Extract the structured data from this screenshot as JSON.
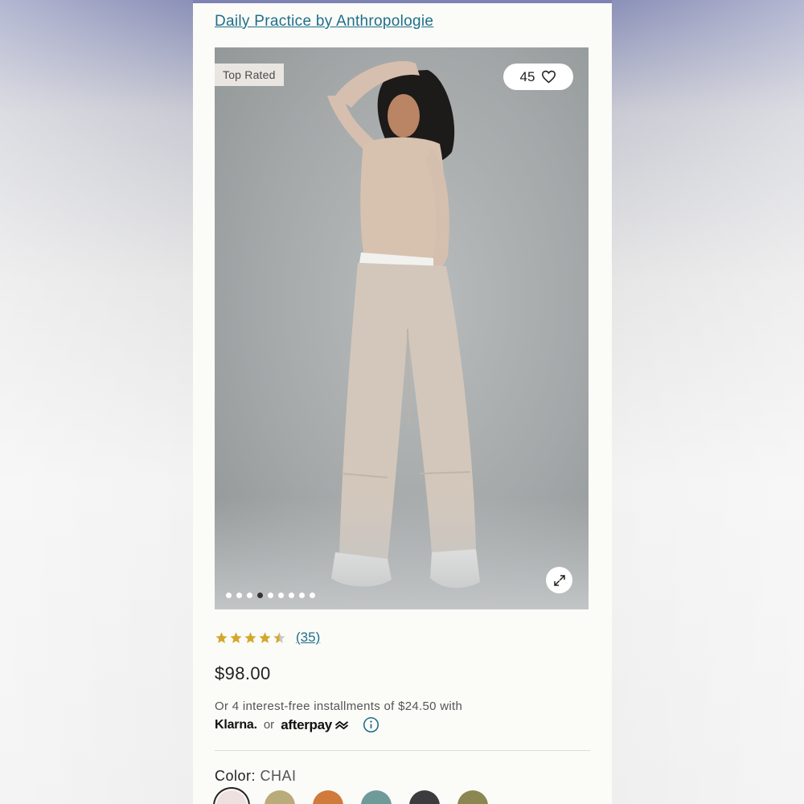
{
  "brand": {
    "link_text": "Daily Practice by Anthropologie"
  },
  "product_image": {
    "badge": "Top Rated",
    "favorites_count": "45",
    "carousel_total": 9,
    "carousel_active_index": 3
  },
  "rating": {
    "stars": 4.5,
    "count_text": "(35)"
  },
  "price": "$98.00",
  "payment": {
    "installments_text": "Or 4 interest-free installments of $24.50 with",
    "klarna": "Klarna.",
    "or": "or",
    "afterpay": "afterpay"
  },
  "color": {
    "label": "Color:",
    "selected": "CHAI",
    "swatches": [
      "#efe0e0",
      "#b9ab7a",
      "#d07a3b",
      "#6f9a9a",
      "#3c3c3e",
      "#8c8752"
    ]
  },
  "icons": [
    "heart-icon",
    "expand-icon",
    "info-icon",
    "star-icon"
  ]
}
